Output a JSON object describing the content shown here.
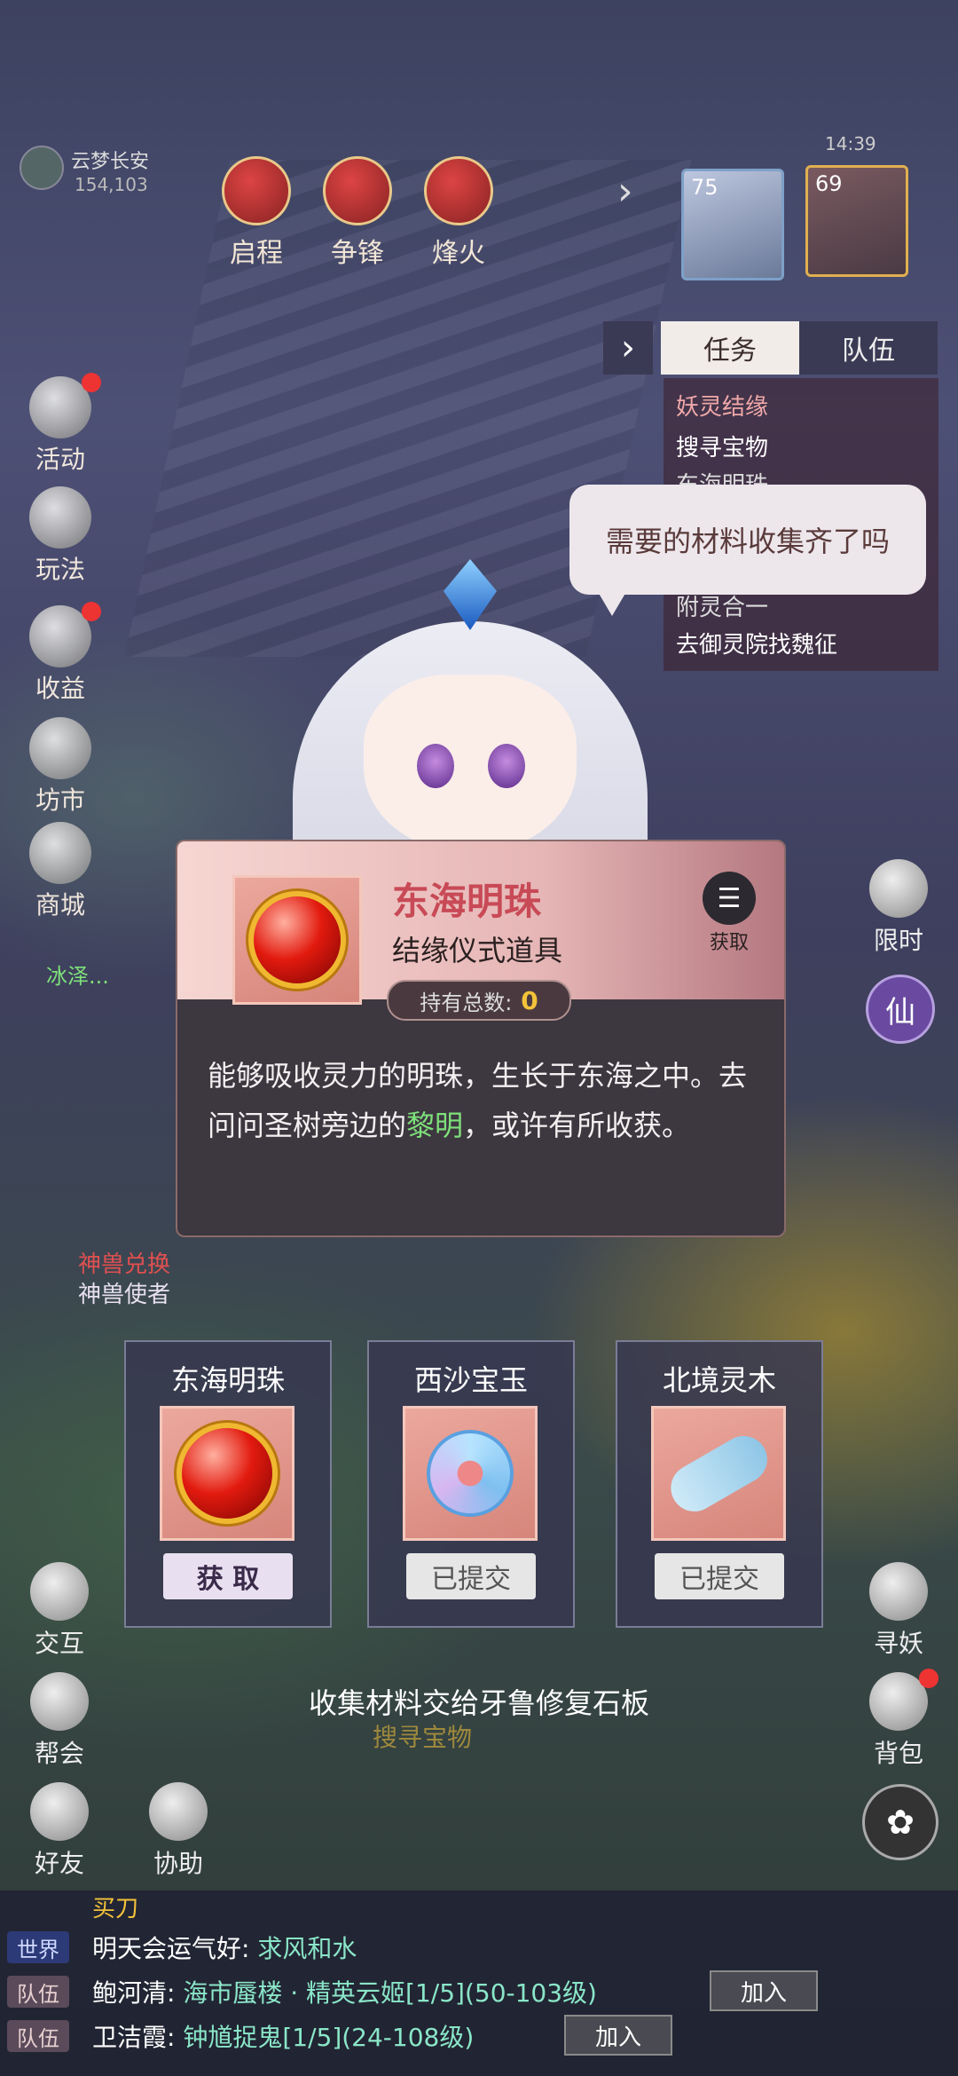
{
  "status_bar": {
    "time": "14:39"
  },
  "location": {
    "name": "云梦长安",
    "coords": "154,103"
  },
  "top_buttons": [
    "启程",
    "争锋",
    "烽火"
  ],
  "party": [
    {
      "level": "75"
    },
    {
      "level": "69"
    }
  ],
  "task_panel": {
    "tabs": [
      "任务",
      "队伍"
    ],
    "tasks": [
      "妖灵结缘",
      "搜寻宝物",
      "东海明珠",
      "附灵合一",
      "去御灵院找魏征"
    ]
  },
  "left_menu": [
    "活动",
    "玩法",
    "收益",
    "坊市",
    "商城"
  ],
  "right_menu": {
    "limited": "限时",
    "immortal": "仙",
    "seek_demon": "寻妖",
    "backpack": "背包"
  },
  "npc_labels": {
    "overhead": "冰泽...",
    "beast_exchange": "神兽兑换",
    "beast_envoy": "神兽使者"
  },
  "bottom_left": [
    "交互",
    "帮会",
    "好友",
    "协助"
  ],
  "speech_bubble": "需要的材料收集齐了吗",
  "item_card": {
    "name": "东海明珠",
    "type": "结缘仪式道具",
    "count_label": "持有总数:",
    "count": "0",
    "get_label": "获取",
    "desc_before": "能够吸收灵力的明珠，生长于东海之中。去问问圣树旁边的",
    "desc_highlight": "黎明",
    "desc_after": "，或许有所收获。"
  },
  "materials": [
    {
      "name": "东海明珠",
      "icon": "red-pearl-icon",
      "button": "获 取",
      "state": "obtain"
    },
    {
      "name": "西沙宝玉",
      "icon": "jade-ring-icon",
      "button": "已提交",
      "state": "submitted"
    },
    {
      "name": "北境灵木",
      "icon": "spirit-wood-icon",
      "button": "已提交",
      "state": "submitted"
    }
  ],
  "hint": "收集材料交给牙鲁修复石板",
  "background_task": "搜寻宝物",
  "chat": {
    "header": "买刀",
    "lines": [
      {
        "channel": "世界",
        "text": "明天会运气好:",
        "link": "求风和水"
      },
      {
        "channel": "队伍",
        "text": "鲍河清:",
        "link": "海市蜃楼 · 精英云姬[1/5](50-103级)",
        "button": "加入"
      },
      {
        "channel": "队伍",
        "text": "卫洁霞:",
        "link": "钟馗捉鬼[1/5](24-108级)",
        "button": "加入"
      }
    ]
  },
  "colors": {
    "item_name": "#c84a56",
    "highlight": "#7ee07a",
    "count": "#f3c23a"
  }
}
